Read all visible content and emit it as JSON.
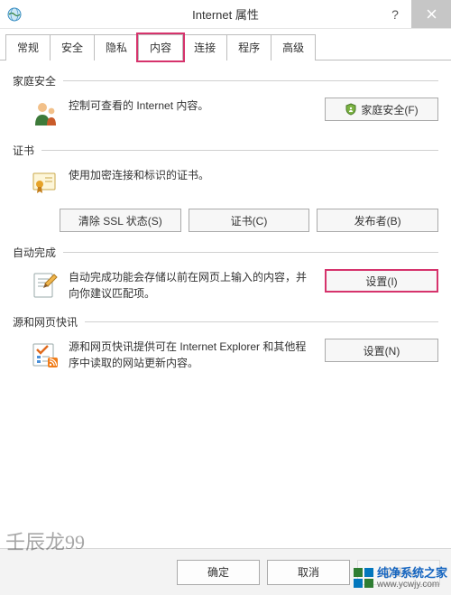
{
  "title": "Internet 属性",
  "tabs": [
    "常规",
    "安全",
    "隐私",
    "内容",
    "连接",
    "程序",
    "高级"
  ],
  "active_tab_index": 3,
  "sections": {
    "family": {
      "title": "家庭安全",
      "desc": "控制可查看的 Internet 内容。",
      "button": "家庭安全(F)"
    },
    "cert": {
      "title": "证书",
      "desc": "使用加密连接和标识的证书。",
      "buttons": [
        "清除 SSL 状态(S)",
        "证书(C)",
        "发布者(B)"
      ]
    },
    "autocomplete": {
      "title": "自动完成",
      "desc": "自动完成功能会存储以前在网页上输入的内容，并向你建议匹配项。",
      "button": "设置(I)"
    },
    "feeds": {
      "title": "源和网页快讯",
      "desc": "源和网页快讯提供可在 Internet Explorer 和其他程序中读取的网站更新内容。",
      "button": "设置(N)"
    }
  },
  "bottom": {
    "ok": "确定",
    "cancel": "取消",
    "apply": "应用(A)"
  },
  "watermark_left": "壬辰龙99",
  "watermark_right": {
    "cn": "纯净系统之家",
    "url": "www.ycwjy.com"
  }
}
